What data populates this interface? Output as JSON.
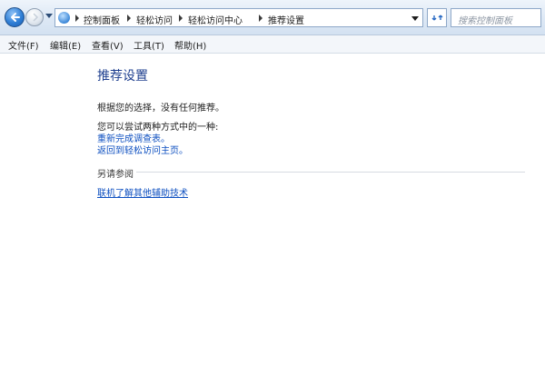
{
  "toolbar": {
    "breadcrumb": [
      "控制面板",
      "轻松访问",
      "轻松访问中心",
      "推荐设置"
    ],
    "search_placeholder": "搜索控制面板"
  },
  "menu": [
    "文件(F)",
    "编辑(E)",
    "查看(V)",
    "工具(T)",
    "帮助(H)"
  ],
  "content": {
    "title": "推荐设置",
    "message": "根据您的选择，没有任何推荐。",
    "prompt": "您可以尝试两种方式中的一种:",
    "links": [
      "重新完成调查表。",
      "返回到轻松访问主页。"
    ],
    "see_also_label": "另请参阅",
    "see_also_link": "联机了解其他辅助技术"
  },
  "colors": {
    "title": "#1e3f8f",
    "link": "#0d4fc0",
    "topbar": "#dde8f5"
  },
  "icons": [
    "back-arrow-icon",
    "forward-arrow-icon",
    "control-panel-icon",
    "refresh-icon"
  ]
}
